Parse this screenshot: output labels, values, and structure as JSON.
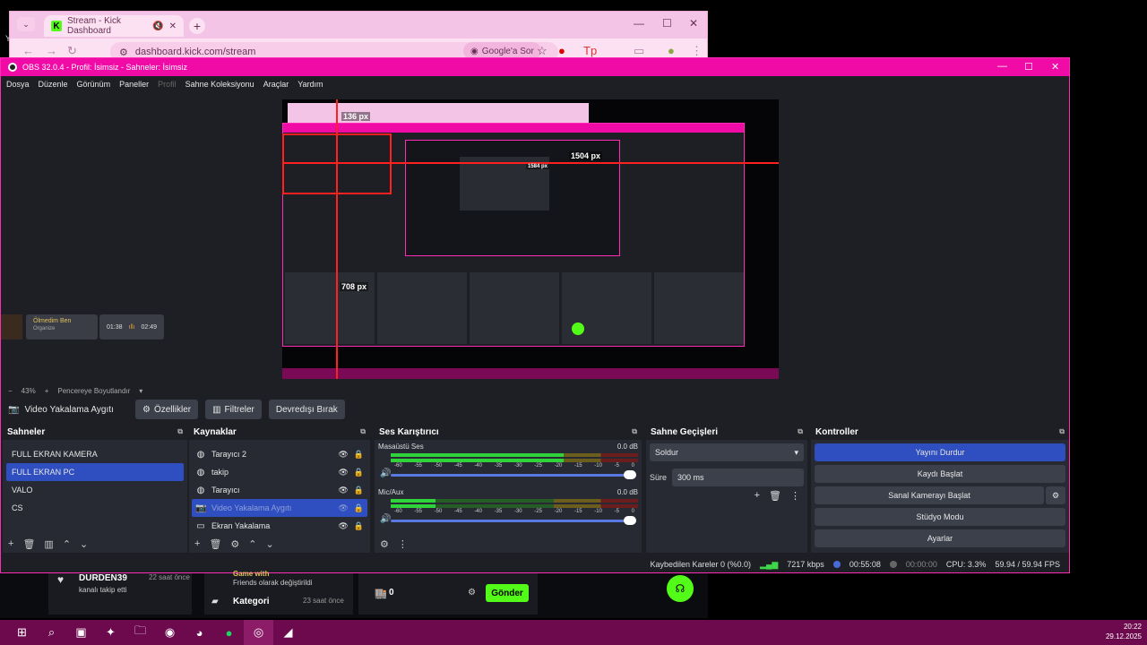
{
  "desktop": {
    "label_fragment": "Ye"
  },
  "browser": {
    "tab_title": "Stream - Kick Dashboard",
    "url": "dashboard.kick.com/stream",
    "google_button": "Google'a Sor"
  },
  "obs": {
    "title": "OBS 32.0.4 - Profil: İsimsiz - Sahneler: İsimsiz",
    "menu": [
      "Dosya",
      "Düzenle",
      "Görünüm",
      "Paneller",
      "Profil",
      "Sahne Koleksiyonu",
      "Araçlar",
      "Yardım"
    ],
    "preview": {
      "measure_top": "136 px",
      "measure_right": "1504 px",
      "measure_inner": "1584 px",
      "measure_left": "708 px"
    },
    "overlay_cards": {
      "song_title": "Ölmedim Ben",
      "song_artist": "Organize",
      "time_start": "01:38",
      "time_end": "02:49"
    },
    "zoom": {
      "minus": "−",
      "value": "43%",
      "plus": "+",
      "fit": "Pencereye Boyutlandır"
    },
    "source_toolbar": {
      "selected_source": "Video Yakalama Aygıtı",
      "properties": "Özellikler",
      "filters": "Filtreler",
      "deactivate": "Devredışı Bırak"
    },
    "scenes": {
      "title": "Sahneler",
      "items": [
        "FULL EKRAN KAMERA",
        "FULL EKRAN PC",
        "VALO",
        "CS"
      ],
      "selected_index": 1
    },
    "sources": {
      "title": "Kaynaklar",
      "items": [
        {
          "name": "Tarayıcı 2",
          "icon": "globe-icon"
        },
        {
          "name": "takip",
          "icon": "globe-icon"
        },
        {
          "name": "Tarayıcı",
          "icon": "globe-icon"
        },
        {
          "name": "Video Yakalama Aygıtı",
          "icon": "camera-icon"
        },
        {
          "name": "Ekran Yakalama",
          "icon": "monitor-icon"
        }
      ]
    },
    "mixer": {
      "title": "Ses Karıştırıcı",
      "channels": [
        {
          "name": "Masaüstü Ses",
          "db": "0.0 dB",
          "level": 0.7
        },
        {
          "name": "Mic/Aux",
          "db": "0.0 dB",
          "level": 0.18
        }
      ],
      "ticks": [
        "-60",
        "-55",
        "-50",
        "-45",
        "-40",
        "-35",
        "-30",
        "-25",
        "-20",
        "-15",
        "-10",
        "-5",
        "0"
      ]
    },
    "transitions": {
      "title": "Sahne Geçişleri",
      "selected": "Soldur",
      "duration_label": "Süre",
      "duration_value": "300 ms"
    },
    "controls": {
      "title": "Kontroller",
      "stop_stream": "Yayını Durdur",
      "start_record": "Kaydı Başlat",
      "virtual_cam": "Sanal Kamerayı Başlat",
      "studio_mode": "Stüdyo Modu",
      "settings": "Ayarlar"
    },
    "status": {
      "dropped": "Kaybedilen Kareler 0 (%0.0)",
      "bitrate": "7217 kbps",
      "stream_time": "00:55:08",
      "rec_time": "00:00:00",
      "cpu": "CPU: 3.3%",
      "fps": "59.94 / 59.94 FPS"
    }
  },
  "kick_bg": {
    "follower_name": "DURDEN39",
    "follower_time": "22 saat önce",
    "follower_text": "kanalı takip etti",
    "game_text_1": "Game with",
    "game_text_2": "Friends olarak değiştirildi",
    "category": "Kategori",
    "category_time": "23 saat önce",
    "count": "0",
    "send": "Gönder"
  },
  "taskbar": {
    "time": "20:22",
    "date": "29.12.2025"
  }
}
